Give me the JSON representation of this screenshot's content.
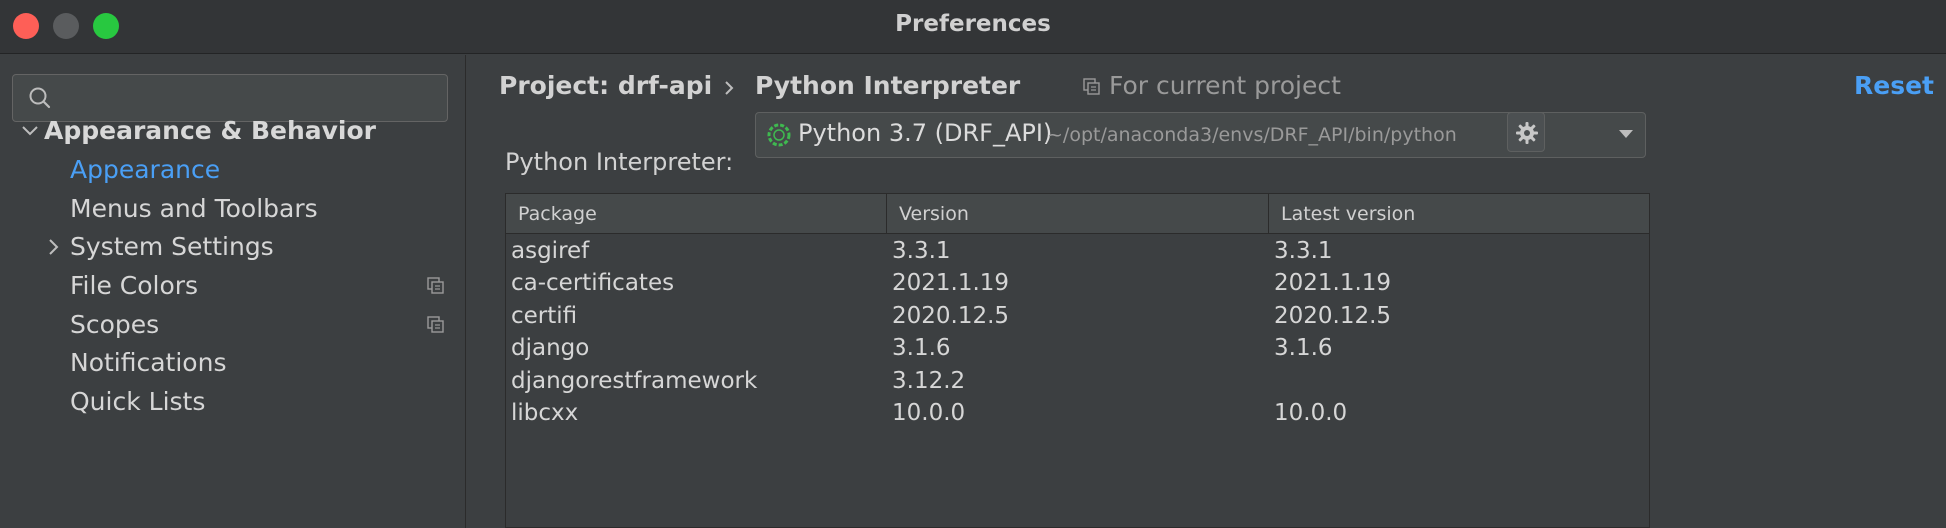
{
  "window": {
    "title": "Preferences"
  },
  "sidebar": {
    "search": {
      "value": "",
      "placeholder": ""
    },
    "items": [
      {
        "label": "Appearance & Behavior",
        "expanded": true,
        "level": 0
      },
      {
        "label": "Appearance",
        "selected": true,
        "level": 1
      },
      {
        "label": "Menus and Toolbars",
        "level": 1
      },
      {
        "label": "System Settings",
        "collapsed": true,
        "level": 1
      },
      {
        "label": "File Colors",
        "project_scoped": true,
        "level": 1
      },
      {
        "label": "Scopes",
        "project_scoped": true,
        "level": 1
      },
      {
        "label": "Notifications",
        "level": 1
      },
      {
        "label": "Quick Lists",
        "level": 1
      }
    ]
  },
  "header": {
    "project": "Project: drf-api",
    "page": "Python Interpreter",
    "scope": "For current project",
    "reset": "Reset"
  },
  "interpreter": {
    "label": "Python Interpreter:",
    "name": "Python 3.7 (DRF_API)",
    "path": "~/opt/anaconda3/envs/DRF_API/bin/python"
  },
  "packages": {
    "columns": [
      "Package",
      "Version",
      "Latest version"
    ],
    "rows": [
      [
        "asgiref",
        "3.3.1",
        "3.3.1"
      ],
      [
        "ca-certificates",
        "2021.1.19",
        "2021.1.19"
      ],
      [
        "certifi",
        "2020.12.5",
        "2020.12.5"
      ],
      [
        "django",
        "3.1.6",
        "3.1.6"
      ],
      [
        "djangorestframework",
        "3.12.2",
        ""
      ],
      [
        "libcxx",
        "10.0.0",
        "10.0.0"
      ]
    ]
  },
  "colors": {
    "accent": "#4a9ff5",
    "background": "#3c3f41",
    "titlebar": "#333537"
  }
}
